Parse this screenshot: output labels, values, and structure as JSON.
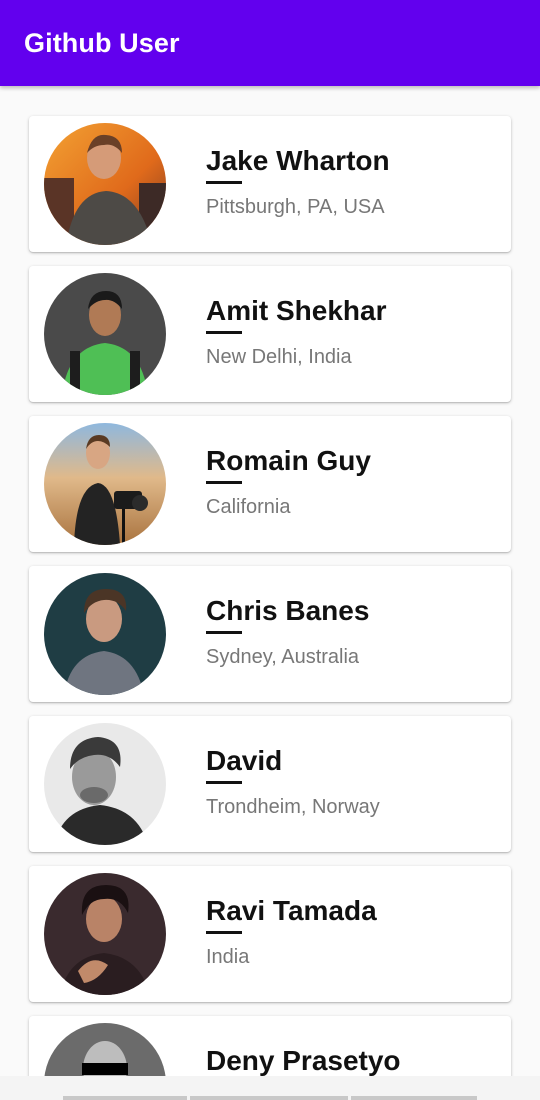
{
  "app_bar": {
    "title": "Github User"
  },
  "users": [
    {
      "name": "Jake Wharton",
      "location": "Pittsburgh, PA, USA"
    },
    {
      "name": "Amit Shekhar",
      "location": "New Delhi, India"
    },
    {
      "name": "Romain Guy",
      "location": "California"
    },
    {
      "name": "Chris Banes",
      "location": "Sydney, Australia"
    },
    {
      "name": "David",
      "location": "Trondheim, Norway"
    },
    {
      "name": "Ravi Tamada",
      "location": "India"
    },
    {
      "name": "Deny Prasetyo",
      "location": ""
    }
  ],
  "colors": {
    "primary": "#6200ee",
    "background": "#fafafa",
    "card": "#ffffff",
    "name_text": "#111111",
    "location_text": "#777777"
  }
}
